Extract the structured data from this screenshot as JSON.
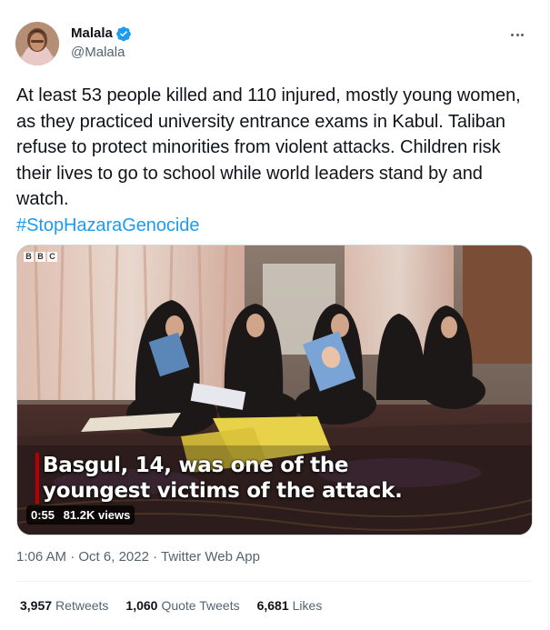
{
  "author": {
    "name": "Malala",
    "handle": "@Malala",
    "verified": true
  },
  "tweet": {
    "text": "At least 53 people killed and 110 injured, mostly young women, as they practiced university entrance exams in Kabul. Taliban refuse to protect minorities from violent attacks. Children risk their lives to go to school while world leaders stand by and watch.",
    "hashtag": "#StopHazaraGenocide"
  },
  "media": {
    "logo": [
      "B",
      "B",
      "C"
    ],
    "caption_line1": "Basgul, 14, was one of the",
    "caption_line2": "youngest victims of the attack.",
    "duration": "0:55",
    "views": "81.2K views"
  },
  "meta": {
    "time": "1:06 AM",
    "separator": "·",
    "date": "Oct 6, 2022",
    "app": "Twitter Web App"
  },
  "stats": [
    {
      "count": "3,957",
      "label": "Retweets"
    },
    {
      "count": "1,060",
      "label": "Quote Tweets"
    },
    {
      "count": "6,681",
      "label": "Likes"
    }
  ],
  "colors": {
    "link": "#1d9bf0",
    "secondary_text": "#536471",
    "caption_bar": "#b80000"
  }
}
